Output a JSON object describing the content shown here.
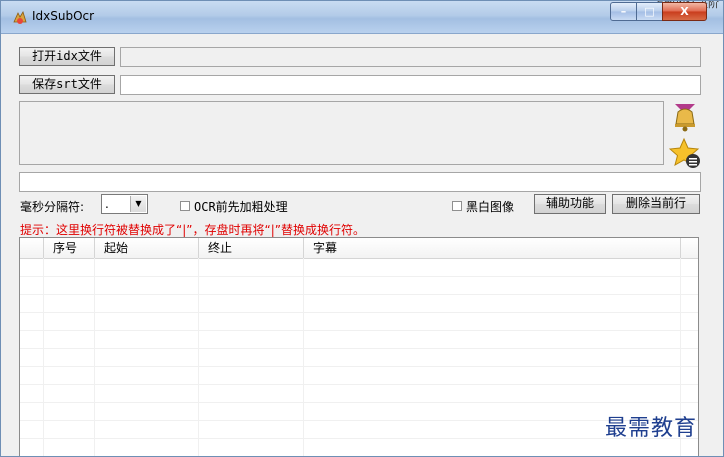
{
  "window": {
    "title": "IdxSubOcr",
    "top_right_text": "上图攻认进阶"
  },
  "window_buttons": {
    "minimize": "–",
    "maximize": "□",
    "close": "X"
  },
  "toolbar": {
    "open_idx": "打开idx文件",
    "save_srt": "保存srt文件",
    "idx_path": "",
    "srt_path": ""
  },
  "options": {
    "ms_separator_label": "毫秒分隔符:",
    "ms_separator_value": ".",
    "ocr_bold_label": "OCR前先加粗处理",
    "bw_image_label": "黑白图像",
    "assist_button": "辅助功能",
    "delete_row_button": "删除当前行"
  },
  "hint": "提示：这里换行符被替换成了“|”，存盘时再将“|”替换成换行符。",
  "table": {
    "columns": [
      "序号",
      "起始",
      "终止",
      "字幕"
    ]
  },
  "watermark": "最需教育",
  "colors": {
    "hint": "#e00000",
    "title_bar": "#b3cbe8",
    "close_button": "#c93b1c"
  }
}
